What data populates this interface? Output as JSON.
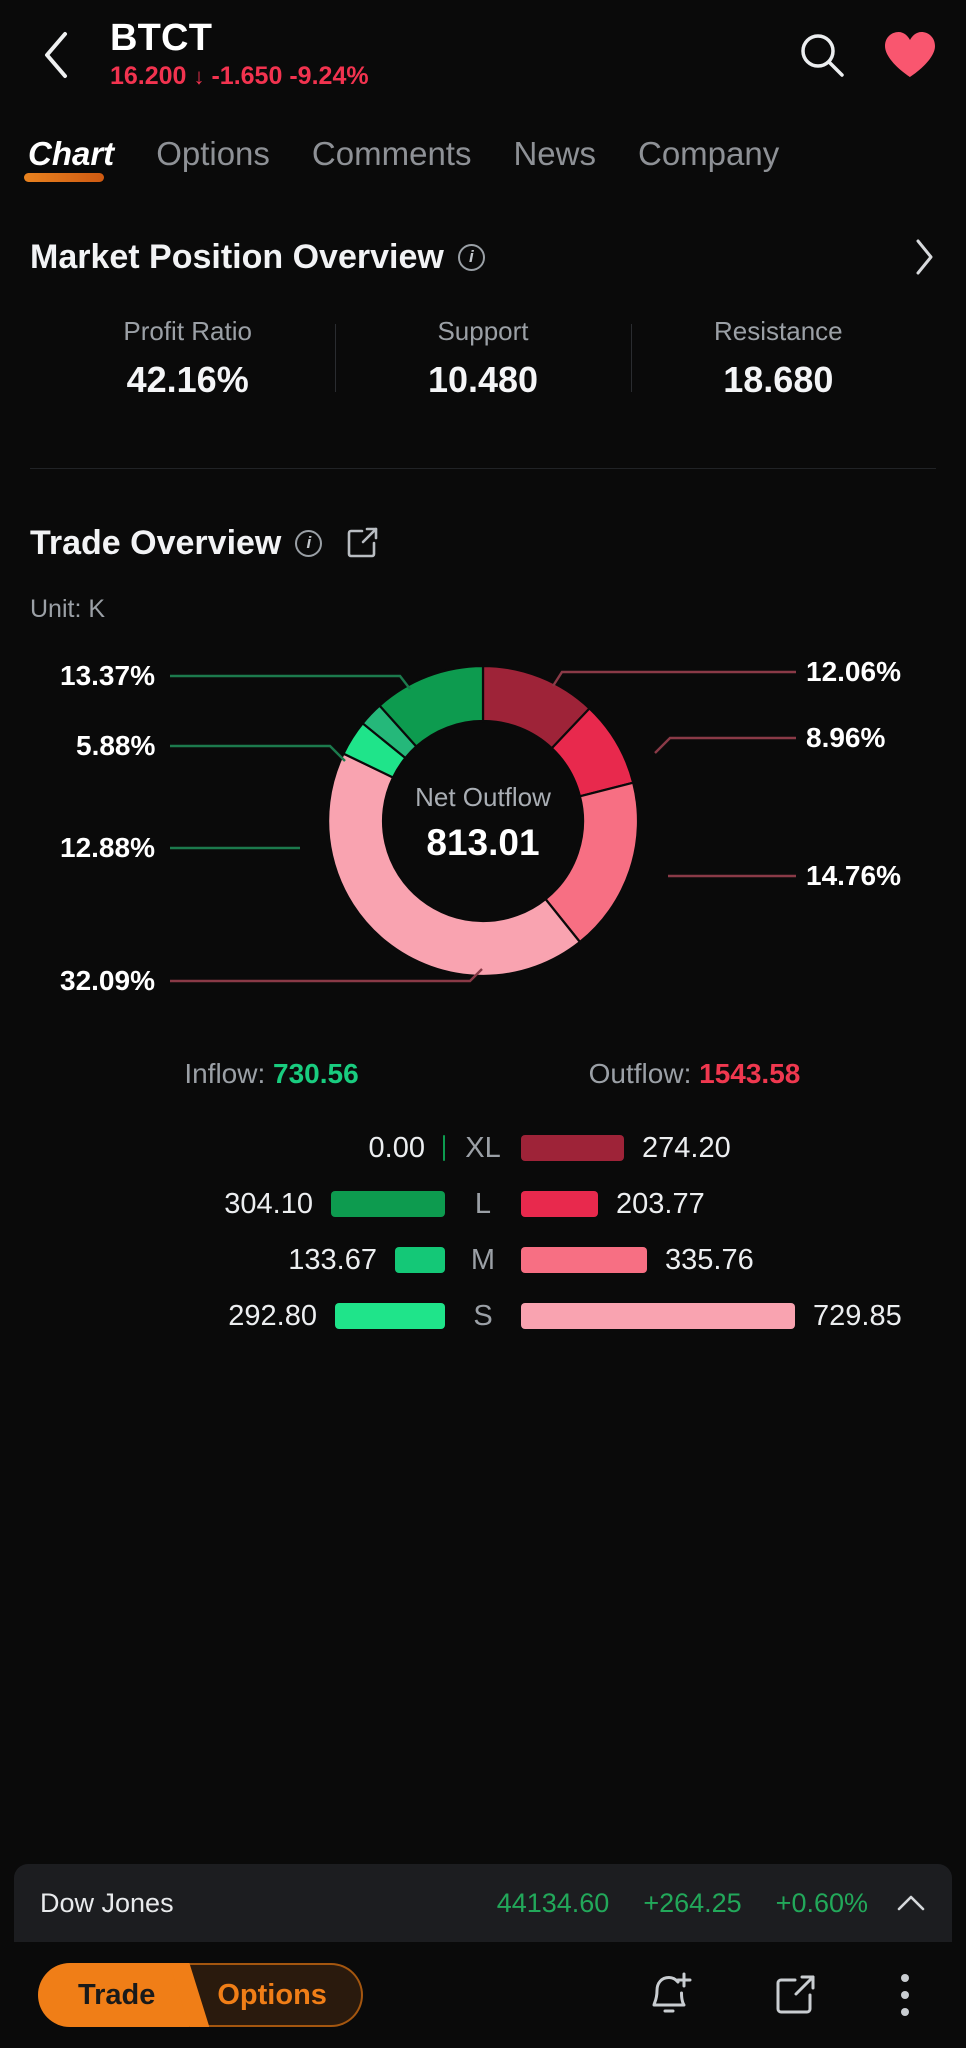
{
  "header": {
    "back_icon": "chevron-left-icon",
    "ticker": "BTCT",
    "price": "16.200",
    "change": "-1.650",
    "change_pct": "-9.24%",
    "down_arrow": "↓",
    "search_icon": "search-icon",
    "favorite_icon": "heart-icon",
    "negative_color": "#f2334f",
    "favorite_color": "#f9566f"
  },
  "tabs": [
    {
      "label": "Chart",
      "active": true
    },
    {
      "label": "Options",
      "active": false
    },
    {
      "label": "Comments",
      "active": false
    },
    {
      "label": "News",
      "active": false
    },
    {
      "label": "Company",
      "active": false
    }
  ],
  "market_position": {
    "title": "Market Position Overview",
    "info_icon": "info-icon",
    "chevron_icon": "chevron-right-icon",
    "stats": [
      {
        "label": "Profit Ratio",
        "value": "42.16%"
      },
      {
        "label": "Support",
        "value": "10.480"
      },
      {
        "label": "Resistance",
        "value": "18.680"
      }
    ]
  },
  "trade_overview": {
    "title": "Trade Overview",
    "info_icon": "info-icon",
    "share_icon": "share-icon",
    "unit": "Unit: K",
    "center_title": "Net Outflow",
    "center_value": "813.01",
    "inflow_label": "Inflow:",
    "inflow_value": "730.56",
    "outflow_label": "Outflow:",
    "outflow_value": "1543.58",
    "bars": [
      {
        "category": "XL",
        "inflow": "0.00",
        "outflow": "274.20",
        "in_w": 2,
        "out_w": 103,
        "in_color": "#0d9b4f",
        "out_color": "#9e2338"
      },
      {
        "category": "L",
        "inflow": "304.10",
        "outflow": "203.77",
        "in_w": 114,
        "out_w": 77,
        "in_color": "#0d9b4f",
        "out_color": "#e8294d"
      },
      {
        "category": "M",
        "inflow": "133.67",
        "outflow": "335.76",
        "in_w": 50,
        "out_w": 126,
        "in_color": "#14c877",
        "out_color": "#f76f83"
      },
      {
        "category": "S",
        "inflow": "292.80",
        "outflow": "729.85",
        "in_w": 110,
        "out_w": 274,
        "in_color": "#1fe48a",
        "out_color": "#f9a3b0"
      }
    ]
  },
  "chart_data": {
    "type": "pie",
    "title": "Trade Overview",
    "subtitle": "Unit: K",
    "center_label": "Net Outflow",
    "center_value": 813.01,
    "legend_position": "callout-labels",
    "categories": [
      "XL Outflow",
      "L Outflow",
      "M Outflow",
      "S Outflow",
      "S Inflow",
      "M Inflow",
      "L Inflow"
    ],
    "values": [
      12.06,
      8.96,
      14.76,
      32.09,
      12.88,
      5.88,
      13.37
    ],
    "labels": [
      "12.06%",
      "8.96%",
      "14.76%",
      "32.09%",
      "12.88%",
      "5.88%",
      "13.37%"
    ],
    "colors": [
      "#9e2338",
      "#e8294d",
      "#f76f83",
      "#f9a3b0",
      "#1fe48a",
      "#25b87a",
      "#0d9b4f"
    ],
    "absolute_values": [
      274.2,
      203.77,
      335.76,
      729.85,
      292.8,
      133.67,
      304.1
    ],
    "totals": {
      "inflow": 730.56,
      "outflow": 1543.58,
      "net_outflow": 813.01
    },
    "ylabel": "",
    "xlabel": "",
    "grid": false
  },
  "index_strip": {
    "name": "Dow Jones",
    "value": "44134.60",
    "change": "+264.25",
    "change_pct": "+0.60%",
    "chevron_icon": "chevron-up-icon",
    "positive_color": "#22a85a"
  },
  "bottom_bar": {
    "trade_label": "Trade",
    "options_label": "Options",
    "alert_icon": "bell-plus-icon",
    "share_icon": "share-icon",
    "more_icon": "more-vertical-icon",
    "accent_color": "#f07e17"
  }
}
